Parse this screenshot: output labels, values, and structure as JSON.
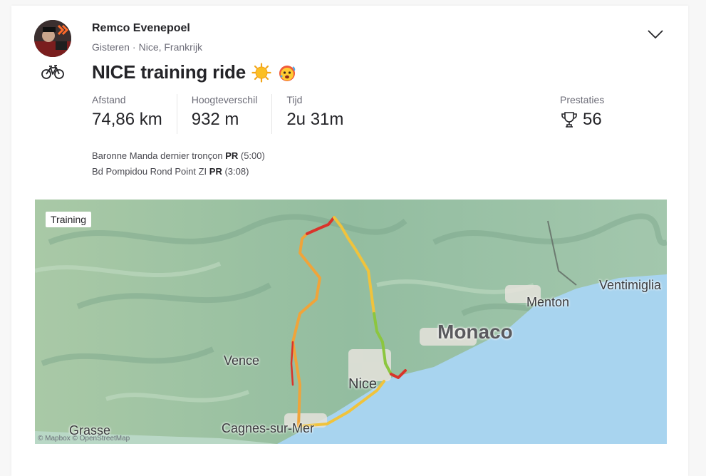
{
  "athlete": {
    "name": "Remco Evenepoel",
    "date": "Gisteren",
    "location": "Nice, Frankrijk",
    "separator": "·"
  },
  "activity": {
    "title": "NICE training ride",
    "emojis": [
      "sun-icon",
      "hot-face-icon"
    ]
  },
  "stats": [
    {
      "label": "Afstand",
      "value": "74,86 km"
    },
    {
      "label": "Hoogteverschil",
      "value": "932 m"
    },
    {
      "label": "Tijd",
      "value": "2u 31m"
    }
  ],
  "achievements": {
    "label": "Prestaties",
    "count": "56",
    "icon": "trophy-icon"
  },
  "prs": [
    {
      "segment": "Baronne Manda dernier tronçon",
      "badge": "PR",
      "time": "(5:00)"
    },
    {
      "segment": "Bd Pompidou Rond Point ZI",
      "badge": "PR",
      "time": "(3:08)"
    }
  ],
  "map": {
    "badge": "Training",
    "attribution": "© Mapbox © OpenStreetMap",
    "places": {
      "ventimiglia": "Ventimiglia",
      "menton": "Menton",
      "monaco": "Monaco",
      "vence": "Vence",
      "nice": "Nice",
      "grasse": "Grasse",
      "cagnes": "Cagnes-sur-Mer"
    }
  },
  "colors": {
    "sea": "#a8d4ef",
    "land": "#9cc2a1",
    "route_red": "#d9342b",
    "route_yellow": "#f0c33c",
    "route_green": "#8cc63f"
  }
}
